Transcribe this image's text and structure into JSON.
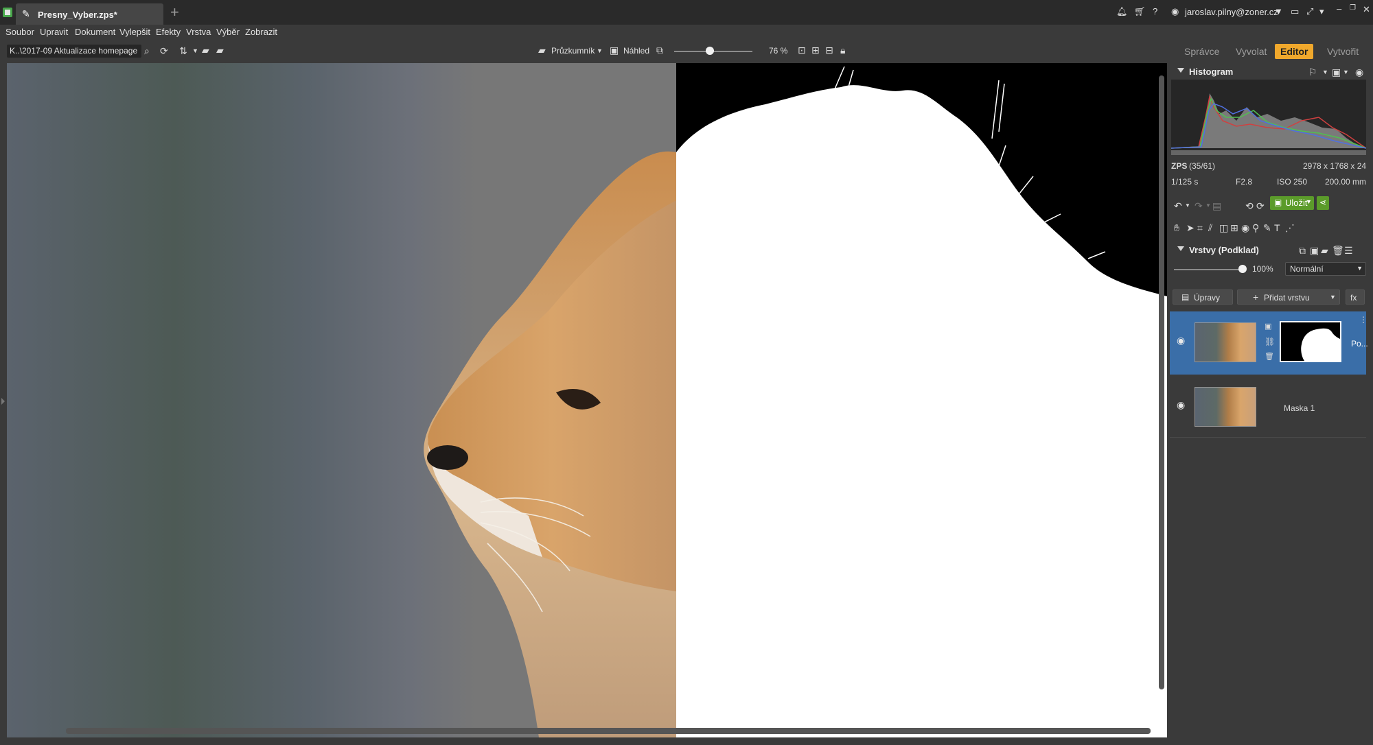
{
  "window": {
    "doc_tab_title": "Presny_Vyber.zps*",
    "new_tab_symbol": "+",
    "user_email": "jaroslav.pilny@zoner.cz",
    "title_icons": [
      "bell-icon",
      "cart-icon",
      "help-icon",
      "user-icon",
      "feedback-icon",
      "fullscreen-icon"
    ],
    "help_symbol": "?"
  },
  "menu": {
    "items": [
      "Soubor",
      "Upravit",
      "Dokument",
      "Vylepšit",
      "Efekty",
      "Vrstva",
      "Výběr",
      "Zobrazit"
    ]
  },
  "toolbar": {
    "path": "K..\\2017-09 Aktualizace homepage",
    "explorer_label": "Průzkumník",
    "preview_label": "Náhled",
    "zoom_value": "76 %",
    "zoom_fraction": 0.4
  },
  "modes": {
    "items": [
      "Správce",
      "Vyvolat",
      "Editor",
      "Vytvořit"
    ],
    "active": "Editor"
  },
  "panel": {
    "histogram_title": "Histogram",
    "file_info": {
      "format": "ZPS",
      "index": "(35/61)",
      "dimensions": "2978 x 1768 x 24",
      "shutter": "1/125 s",
      "aperture": "F2.8",
      "iso": "ISO 250",
      "focal": "200.00 mm"
    },
    "save_label": "Uložit",
    "layers_title": "Vrstvy (Podklad)",
    "opacity_value": "100%",
    "opacity_fraction": 1.0,
    "blend_mode": "Normální",
    "adjust_label": "Úpravy",
    "add_layer_label": "Přidat vrstvu",
    "fx_label": "fx",
    "layers": [
      {
        "name": "Po...",
        "selected": true
      },
      {
        "name": "Maska 1",
        "selected": false
      }
    ]
  },
  "colors": {
    "accent": "#f0a82c",
    "save_green": "#5b9b2a",
    "selection_blue": "#3a6ea8"
  }
}
